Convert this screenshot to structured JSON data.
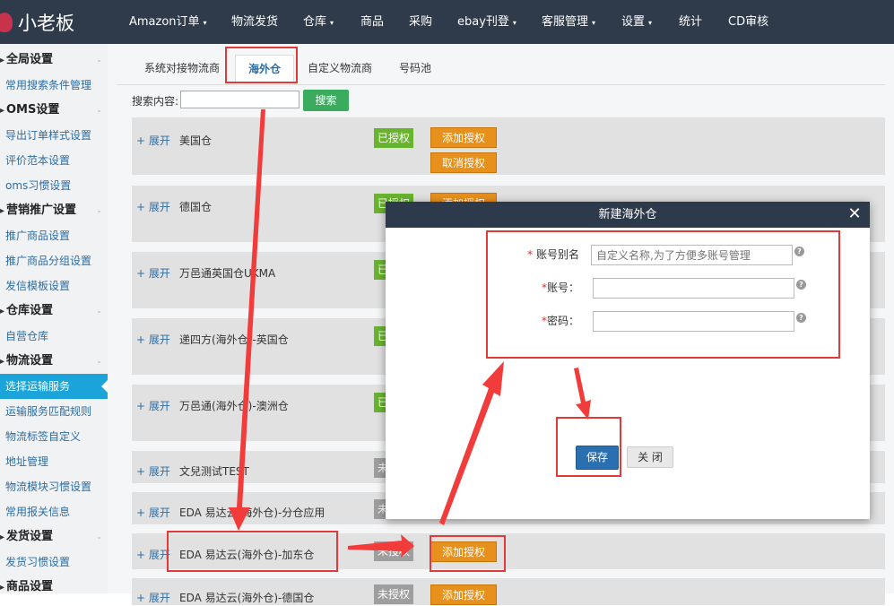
{
  "app": {
    "title": "小老板"
  },
  "topnav": [
    {
      "label": "Amazon订单",
      "caret": true
    },
    {
      "label": "物流发货",
      "caret": false
    },
    {
      "label": "仓库",
      "caret": true
    },
    {
      "label": "商品",
      "caret": false
    },
    {
      "label": "采购",
      "caret": false
    },
    {
      "label": "ebay刊登",
      "caret": true
    },
    {
      "label": "客服管理",
      "caret": true
    },
    {
      "label": "设置",
      "caret": true
    },
    {
      "label": "统计",
      "caret": false
    },
    {
      "label": "CD审核",
      "caret": false
    }
  ],
  "sidebar": {
    "sections": [
      {
        "title": "全局设置",
        "items": [
          "常用搜索条件管理"
        ]
      },
      {
        "title": "OMS设置",
        "items": [
          "导出订单样式设置",
          "评价范本设置",
          "oms习惯设置"
        ]
      },
      {
        "title": "营销推广设置",
        "items": [
          "推广商品设置",
          "推广商品分组设置",
          "发信模板设置"
        ]
      },
      {
        "title": "仓库设置",
        "items": [
          "自营仓库"
        ]
      },
      {
        "title": "物流设置",
        "items": [
          "选择运输服务",
          "运输服务匹配规则",
          "物流标签自定义",
          "地址管理",
          "物流模块习惯设置",
          "常用报关信息"
        ]
      },
      {
        "title": "发货设置",
        "items": [
          "发货习惯设置"
        ]
      },
      {
        "title": "商品设置",
        "items": []
      }
    ],
    "active_item": "选择运输服务"
  },
  "tabs": [
    "系统对接物流商",
    "海外仓",
    "自定义物流商",
    "号码池"
  ],
  "active_tab": "海外仓",
  "search": {
    "label": "搜索内容:",
    "button": "搜索",
    "value": ""
  },
  "rows": [
    {
      "expand": "+ 展开",
      "name": "美国仓",
      "status": "已授权",
      "authorized": true,
      "actions": [
        "添加授权",
        "取消授权"
      ]
    },
    {
      "expand": "+ 展开",
      "name": "德国仓",
      "status": "已授权",
      "authorized": true,
      "actions": [
        "添加授权"
      ]
    },
    {
      "expand": "+ 展开",
      "name": "万邑通英国仓UKMA",
      "status": "已授权",
      "authorized": true,
      "actions": []
    },
    {
      "expand": "+ 展开",
      "name": "递四方(海外仓)-英国仓",
      "status": "已授权",
      "authorized": true,
      "actions": []
    },
    {
      "expand": "+ 展开",
      "name": "万邑通(海外仓)-澳洲仓",
      "status": "已授权",
      "authorized": true,
      "actions": []
    },
    {
      "expand": "+ 展开",
      "name": "文兒测试TEST",
      "status": "未授权",
      "authorized": false,
      "actions": []
    },
    {
      "expand": "+ 展开",
      "name": "EDA 易达云(海外仓)-分仓应用",
      "status": "未授权",
      "authorized": false,
      "actions": []
    },
    {
      "expand": "+ 展开",
      "name": "EDA 易达云(海外仓)-加东仓",
      "status": "未授权",
      "authorized": false,
      "actions": [
        "添加授权"
      ]
    },
    {
      "expand": "+ 展开",
      "name": "EDA 易达云(海外仓)-德国仓",
      "status": "未授权",
      "authorized": false,
      "actions": [
        "添加授权"
      ]
    }
  ],
  "modal": {
    "title": "新建海外仓",
    "fields": [
      {
        "label": "账号别名",
        "placeholder": "自定义名称,为了方便多账号管理",
        "value": ""
      },
      {
        "label": "账号：",
        "placeholder": "",
        "value": ""
      },
      {
        "label": "密码：",
        "placeholder": "",
        "value": ""
      }
    ],
    "save": "保存",
    "close": "关 闭"
  },
  "colors": {
    "topbar": "#2f3b4a",
    "accent": "#1ba4d9",
    "authorized": "#69b42f",
    "unauthorized": "#9e9e9e",
    "action": "#e8901c",
    "annotation": "#e03a3a"
  }
}
